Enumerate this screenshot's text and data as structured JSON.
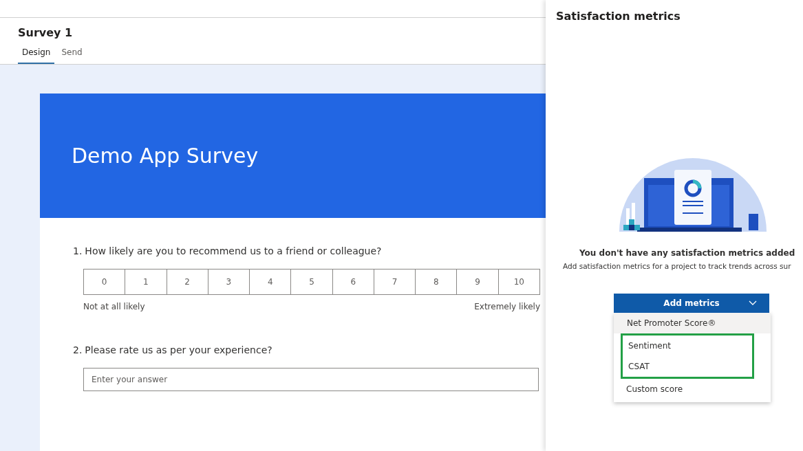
{
  "survey": {
    "title": "Survey 1",
    "tabs": [
      {
        "label": "Design",
        "selected": true
      },
      {
        "label": "Send",
        "selected": false
      }
    ],
    "banner_title": "Demo App Survey",
    "questions": [
      {
        "kind": "scale",
        "number": "1.",
        "text": "How likely are you to recommend us to a friend or colleague?",
        "options": [
          "0",
          "1",
          "2",
          "3",
          "4",
          "5",
          "6",
          "7",
          "8",
          "9",
          "10"
        ],
        "low_label": "Not at all likely",
        "high_label": "Extremely likely"
      },
      {
        "kind": "text",
        "number": "2.",
        "text": "Please rate us as per your experience?",
        "placeholder": "Enter your answer"
      }
    ]
  },
  "panel": {
    "title": "Satisfaction metrics",
    "empty_title": "You don't have any satisfaction metrics added",
    "empty_text": "Add satisfaction metrics for a project to track trends across sur",
    "dropdown": {
      "label": "Add metrics",
      "expanded": true,
      "items": [
        {
          "label": "Net Promoter Score®",
          "highlighted": true,
          "outlined": false
        },
        {
          "label": "Sentiment",
          "highlighted": false,
          "outlined": true
        },
        {
          "label": "CSAT",
          "highlighted": false,
          "outlined": true
        },
        {
          "label": "Custom score",
          "highlighted": false,
          "outlined": false
        }
      ]
    }
  }
}
